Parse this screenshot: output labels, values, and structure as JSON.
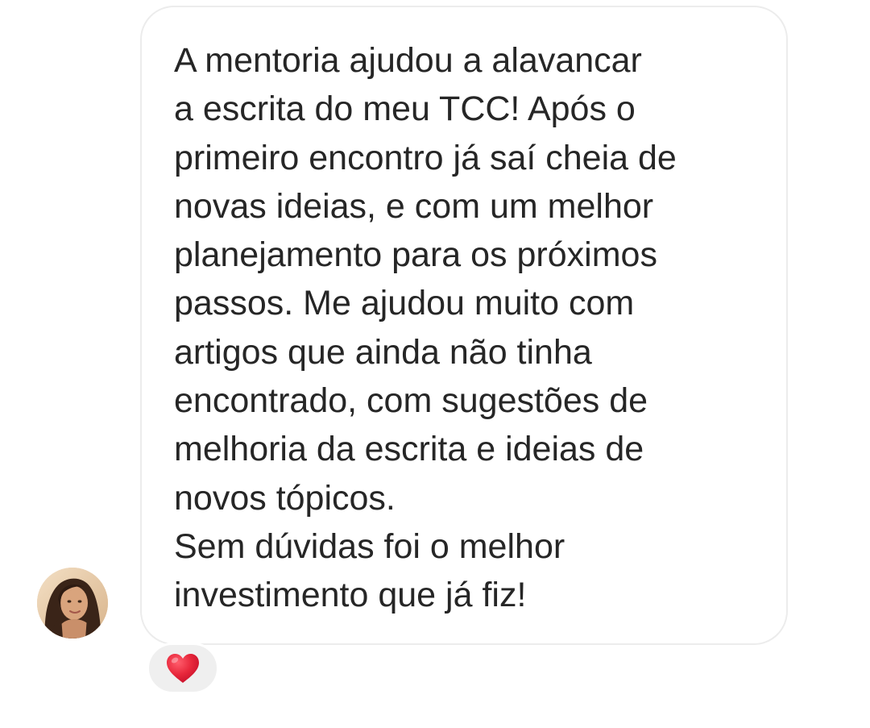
{
  "message": {
    "lines": [
      "A mentoria ajudou a alavancar",
      "a escrita do meu TCC! Após o",
      "primeiro encontro já saí cheia de",
      "novas ideias, e com um melhor",
      "planejamento para os próximos",
      "passos. Me ajudou muito com",
      "artigos que ainda não tinha",
      "encontrado, com sugestões de",
      "melhoria da escrita e ideias de",
      "novos tópicos.",
      "Sem dúvidas foi o melhor",
      "investimento que já fiz!"
    ]
  },
  "sender": {
    "avatar_icon": "profile-photo"
  },
  "reaction": {
    "icon": "red-heart-icon",
    "color": "#e8283c"
  }
}
